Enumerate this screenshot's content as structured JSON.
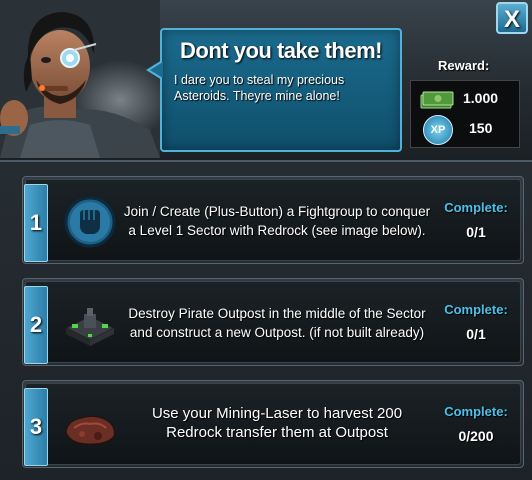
{
  "dialog": {
    "title": "Dont you take them!",
    "text": "I dare you to steal my precious Asteroids. Theyre mine alone!",
    "close_label": "X"
  },
  "reward": {
    "label": "Reward:",
    "money": "1.000",
    "xp_badge": "XP",
    "xp": "150"
  },
  "complete_label": "Complete:",
  "tasks": [
    {
      "number": "1",
      "line1": "Join / Create (Plus-Button) a Fightgroup to conquer",
      "line2": "a Level 1 Sector with Redrock (see image below).",
      "progress": "0/1",
      "icon": "fist-icon"
    },
    {
      "number": "2",
      "line1": "Destroy Pirate Outpost in the middle of the Sector",
      "line2": "and construct a new Outpost. (if not built already)",
      "progress": "0/1",
      "icon": "outpost-icon"
    },
    {
      "number": "3",
      "line1": "Use your Mining-Laser to harvest 200",
      "line2": "Redrock  transfer them at Outpost",
      "progress": "0/200",
      "icon": "redrock-icon"
    }
  ],
  "colors": {
    "accent_blue": "#4ec0e8",
    "speech_bg": "#1b6b8e"
  }
}
